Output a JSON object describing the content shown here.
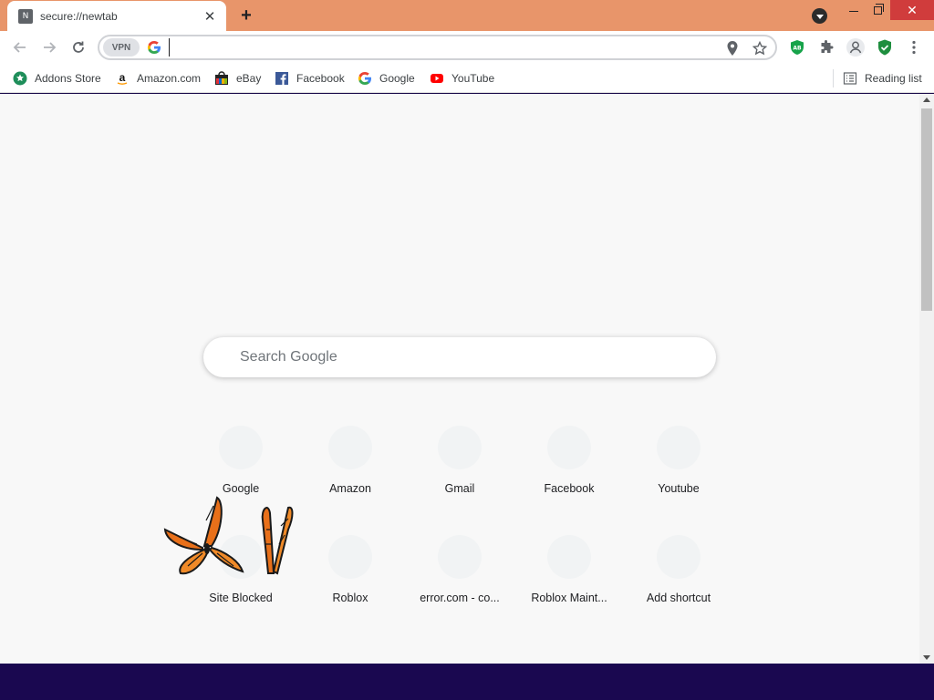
{
  "browser": {
    "tab": {
      "favicon": "N",
      "title": "secure://newtab",
      "close": "✕"
    },
    "new_tab": "+",
    "window": {
      "minimize": "minimize",
      "maximize": "maximize",
      "close": "✕"
    }
  },
  "toolbar": {
    "vpn_label": "VPN",
    "address_value": "",
    "address_placeholder": ""
  },
  "bookmarks": [
    {
      "label": "Addons Store",
      "icon": "addons-store-icon"
    },
    {
      "label": "Amazon.com",
      "icon": "amazon-icon"
    },
    {
      "label": "eBay",
      "icon": "ebay-icon"
    },
    {
      "label": "Facebook",
      "icon": "facebook-icon"
    },
    {
      "label": "Google",
      "icon": "google-icon"
    },
    {
      "label": "YouTube",
      "icon": "youtube-icon"
    }
  ],
  "reading_list": "Reading list",
  "search": {
    "placeholder": "Search Google"
  },
  "shortcuts": [
    {
      "label": "Google"
    },
    {
      "label": "Amazon"
    },
    {
      "label": "Gmail"
    },
    {
      "label": "Facebook"
    },
    {
      "label": "Youtube"
    },
    {
      "label": "Site Blocked"
    },
    {
      "label": "Roblox"
    },
    {
      "label": "error.com - co..."
    },
    {
      "label": "Roblox Maint..."
    },
    {
      "label": "Add shortcut"
    }
  ],
  "colors": {
    "title_bar": "#e8956a",
    "taskbar": "#1a0850",
    "close_button": "#d03c3c",
    "page_background": "#f8f8f8"
  }
}
